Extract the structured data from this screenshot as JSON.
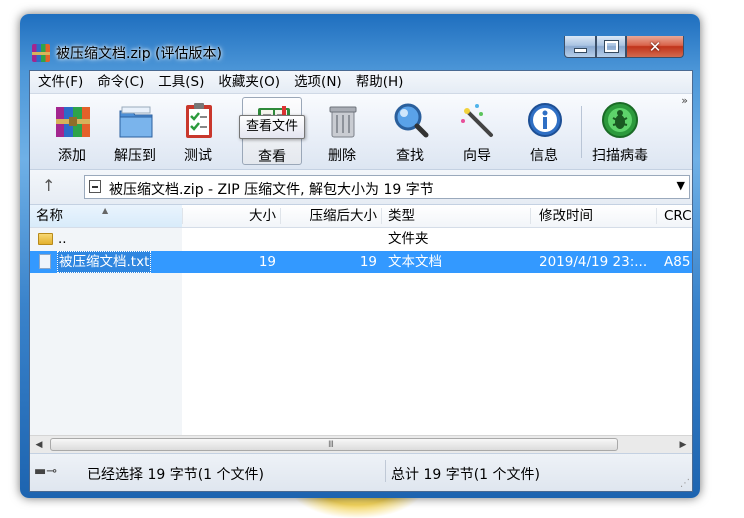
{
  "window": {
    "title": "被压缩文档.zip (评估版本)",
    "close_glyph": "✕"
  },
  "menu": [
    "文件(F)",
    "命令(C)",
    "工具(S)",
    "收藏夹(O)",
    "选项(N)",
    "帮助(H)"
  ],
  "toolbar": {
    "buttons": [
      {
        "label": "添加",
        "icon": "add-archive-icon"
      },
      {
        "label": "解压到",
        "icon": "extract-folder-icon"
      },
      {
        "label": "测试",
        "icon": "test-clipboard-icon"
      },
      {
        "label": "查看",
        "icon": "view-book-icon"
      },
      {
        "label": "删除",
        "icon": "trash-icon"
      },
      {
        "label": "查找",
        "icon": "magnifier-icon"
      },
      {
        "label": "向导",
        "icon": "wizard-wand-icon"
      },
      {
        "label": "信息",
        "icon": "info-icon"
      },
      {
        "label": "扫描病毒",
        "icon": "virus-scan-icon"
      }
    ],
    "more": "»",
    "tooltip": "查看文件"
  },
  "address": {
    "up": "↑",
    "text": "被压缩文档.zip - ZIP 压缩文件, 解包大小为 19 字节",
    "dropdown": "▼"
  },
  "columns": [
    "名称",
    "大小",
    "压缩后大小",
    "类型",
    "修改时间",
    "CRC"
  ],
  "rows": [
    {
      "name": "..",
      "size": "",
      "packed": "",
      "type": "文件夹",
      "modified": "",
      "crc": ""
    },
    {
      "name": "被压缩文档.txt",
      "size": "19",
      "packed": "19",
      "type": "文本文档",
      "modified": "2019/4/19 23:...",
      "crc": "A85"
    }
  ],
  "scroll": {
    "left": "◀",
    "right": "▶",
    "grip": "III"
  },
  "status": {
    "left": "已经选择 19 字节(1 个文件)",
    "right": "总计 19 字节(1 个文件)"
  },
  "colors": {
    "selection": "#3399ff",
    "frame": "#4d97d8"
  }
}
